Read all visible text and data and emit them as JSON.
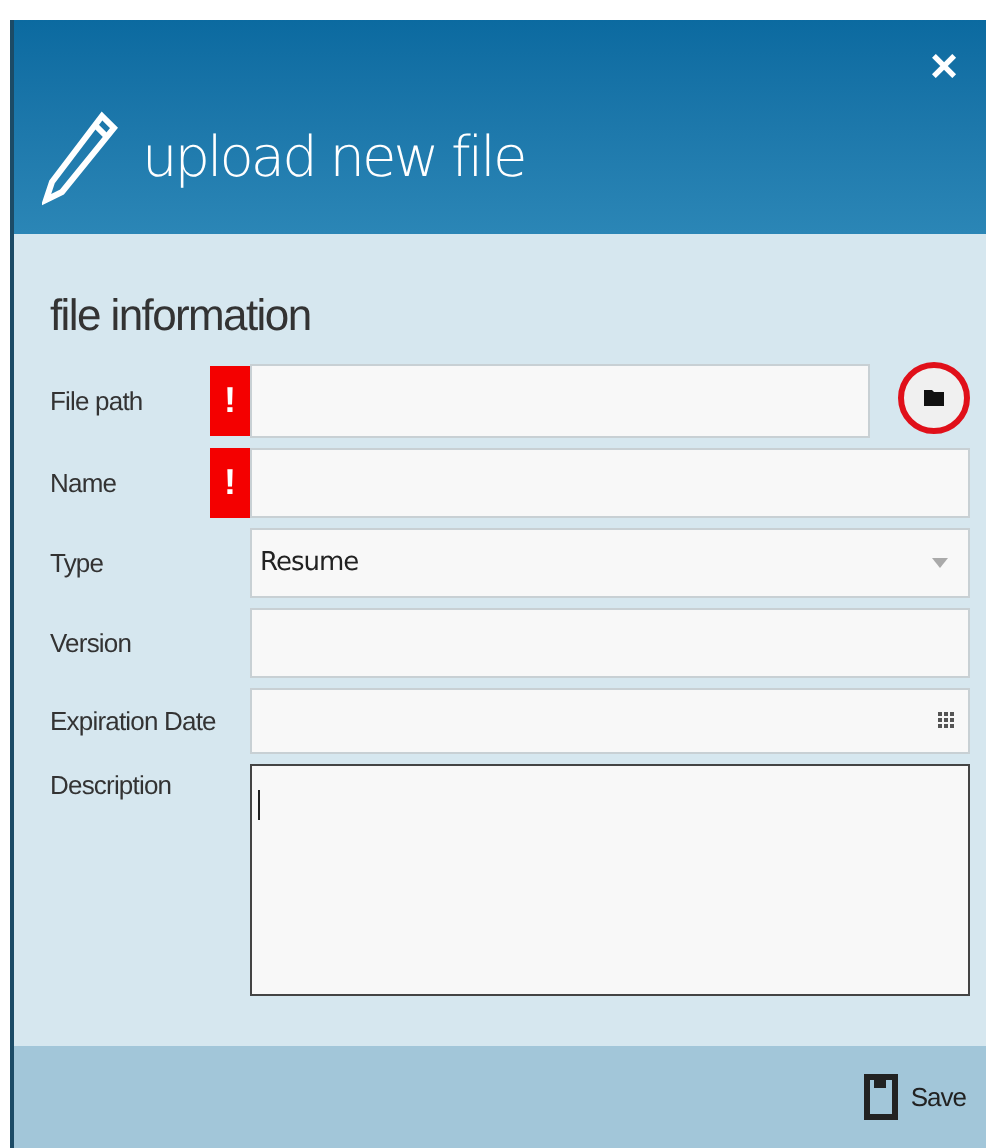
{
  "dialog": {
    "title": "upload new file",
    "close": "×"
  },
  "section": {
    "title": "file information"
  },
  "fields": [
    {
      "kind": "file",
      "label": "File path",
      "required": true,
      "marker": "!",
      "focused": false
    },
    {
      "kind": "text",
      "label": "Name",
      "required": true,
      "marker": "!",
      "focused": false
    },
    {
      "kind": "select",
      "label": "Type",
      "required": false,
      "value": "Resume",
      "focused": false
    },
    {
      "kind": "text",
      "label": "Version",
      "required": false,
      "focused": false
    },
    {
      "kind": "date",
      "label": "Expiration Date",
      "required": false,
      "focused": false
    },
    {
      "kind": "textarea",
      "label": "Description",
      "required": false,
      "focused": true
    }
  ],
  "footer": {
    "save": "Save"
  }
}
